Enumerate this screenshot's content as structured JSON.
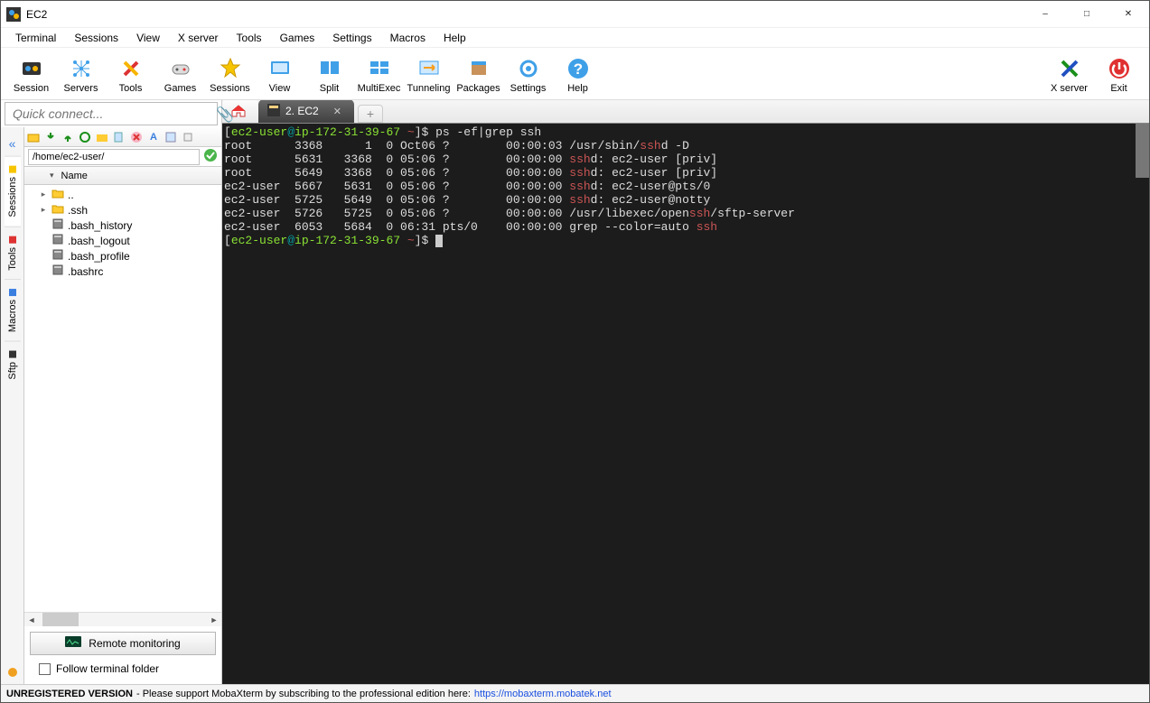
{
  "window": {
    "title": "EC2"
  },
  "menu": [
    "Terminal",
    "Sessions",
    "View",
    "X server",
    "Tools",
    "Games",
    "Settings",
    "Macros",
    "Help"
  ],
  "toolbar": {
    "items": [
      {
        "k": "session",
        "label": "Session"
      },
      {
        "k": "servers",
        "label": "Servers"
      },
      {
        "k": "tools",
        "label": "Tools"
      },
      {
        "k": "games",
        "label": "Games"
      },
      {
        "k": "sessions",
        "label": "Sessions"
      },
      {
        "k": "view",
        "label": "View"
      },
      {
        "k": "split",
        "label": "Split"
      },
      {
        "k": "multiexec",
        "label": "MultiExec"
      },
      {
        "k": "tunneling",
        "label": "Tunneling"
      },
      {
        "k": "packages",
        "label": "Packages"
      },
      {
        "k": "settings",
        "label": "Settings"
      },
      {
        "k": "help",
        "label": "Help"
      }
    ],
    "right": [
      {
        "k": "xserver",
        "label": "X server"
      },
      {
        "k": "exit",
        "label": "Exit"
      }
    ]
  },
  "quick_connect": {
    "placeholder": "Quick connect..."
  },
  "side_tabs": [
    "Sessions",
    "Tools",
    "Macros",
    "Sftp"
  ],
  "sftp": {
    "path": "/home/ec2-user/",
    "header": "Name",
    "items": [
      {
        "icon": "folder-up",
        "name": ".."
      },
      {
        "icon": "folder",
        "name": ".ssh"
      },
      {
        "icon": "file",
        "name": ".bash_history"
      },
      {
        "icon": "file",
        "name": ".bash_logout"
      },
      {
        "icon": "file",
        "name": ".bash_profile"
      },
      {
        "icon": "file",
        "name": ".bashrc"
      }
    ],
    "remote_monitor": "Remote monitoring",
    "follow": "Follow terminal folder"
  },
  "tabs": {
    "active_label": "2. EC2"
  },
  "terminal": {
    "prompt_user": "ec2-user",
    "prompt_host": "ip-172-31-39-67",
    "prompt_dir": "~",
    "cmd": "ps -ef|grep ssh",
    "rows": [
      {
        "user": "root    ",
        "pid": " 3368",
        "ppid": "    1",
        "c": " 0",
        "stime": "Oct06",
        "tty": "?    ",
        "time": "00:00:03",
        "cmd_pre": "/usr/sbin/",
        "hl": "ssh",
        "cmd_post": "d -D"
      },
      {
        "user": "root    ",
        "pid": " 5631",
        "ppid": " 3368",
        "c": " 0",
        "stime": "05:06",
        "tty": "?    ",
        "time": "00:00:00",
        "cmd_pre": "",
        "hl": "ssh",
        "cmd_post": "d: ec2-user [priv]"
      },
      {
        "user": "root    ",
        "pid": " 5649",
        "ppid": " 3368",
        "c": " 0",
        "stime": "05:06",
        "tty": "?    ",
        "time": "00:00:00",
        "cmd_pre": "",
        "hl": "ssh",
        "cmd_post": "d: ec2-user [priv]"
      },
      {
        "user": "ec2-user",
        "pid": " 5667",
        "ppid": " 5631",
        "c": " 0",
        "stime": "05:06",
        "tty": "?    ",
        "time": "00:00:00",
        "cmd_pre": "",
        "hl": "ssh",
        "cmd_post": "d: ec2-user@pts/0"
      },
      {
        "user": "ec2-user",
        "pid": " 5725",
        "ppid": " 5649",
        "c": " 0",
        "stime": "05:06",
        "tty": "?    ",
        "time": "00:00:00",
        "cmd_pre": "",
        "hl": "ssh",
        "cmd_post": "d: ec2-user@notty"
      },
      {
        "user": "ec2-user",
        "pid": " 5726",
        "ppid": " 5725",
        "c": " 0",
        "stime": "05:06",
        "tty": "?    ",
        "time": "00:00:00",
        "cmd_pre": "/usr/libexec/open",
        "hl": "ssh",
        "cmd_post": "/sftp-server"
      },
      {
        "user": "ec2-user",
        "pid": " 6053",
        "ppid": " 5684",
        "c": " 0",
        "stime": "06:31",
        "tty": "pts/0",
        "time": "00:00:00",
        "cmd_pre": "grep --color=auto ",
        "hl": "ssh",
        "cmd_post": ""
      }
    ]
  },
  "status": {
    "unreg": "UNREGISTERED VERSION",
    "msg": " -  Please support MobaXterm by subscribing to the professional edition here:  ",
    "link": "https://mobaxterm.mobatek.net"
  }
}
